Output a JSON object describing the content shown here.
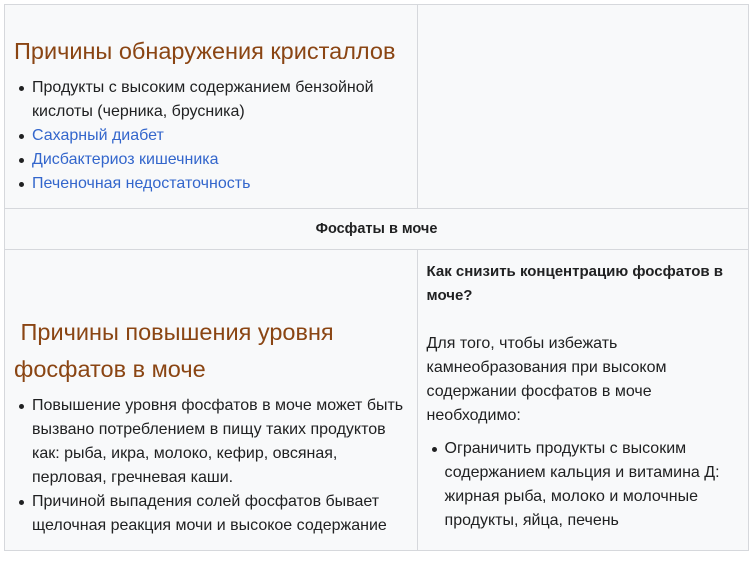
{
  "section1": {
    "title": "Причины обнаружения кристаллов",
    "items": [
      {
        "text": "Продукты с высоким содержанием бензойной кислоты (черника, брусника)",
        "link": false
      },
      {
        "text": "Сахарный диабет",
        "link": true
      },
      {
        "text": "Дисбактериоз кишечника",
        "link": true
      },
      {
        "text": "Печеночная недостаточность",
        "link": true
      }
    ]
  },
  "banner": {
    "text": "Фосфаты в моче"
  },
  "section2": {
    "title": " Причины повышения уровня фосфатов в моче",
    "items": [
      {
        "text": "Повышение уровня фосфатов в моче может быть вызвано потреблением в пищу таких продуктов как: рыба, икра, молоко, кефир, овсяная, перловая, гречневая каши."
      },
      {
        "text": "Причиной выпадения солей фосфатов бывает щелочная реакция мочи и высокое содержание"
      }
    ]
  },
  "sidebar": {
    "question": "Как снизить концентрацию фосфатов в моче?",
    "text": "Для того, чтобы избежать камнеобразования при высоком содержании фосфатов в моче необходимо:",
    "items": [
      {
        "text": "Ограничить продукты с высоким содержанием кальция и витамина Д: жирная рыба, молоко и молочные продукты, яйца, печень"
      }
    ]
  },
  "colors": {
    "heading": "#8a4513",
    "link": "#3366cc",
    "table_bg": "#f8f9fa",
    "border": "#d6d8dc"
  }
}
